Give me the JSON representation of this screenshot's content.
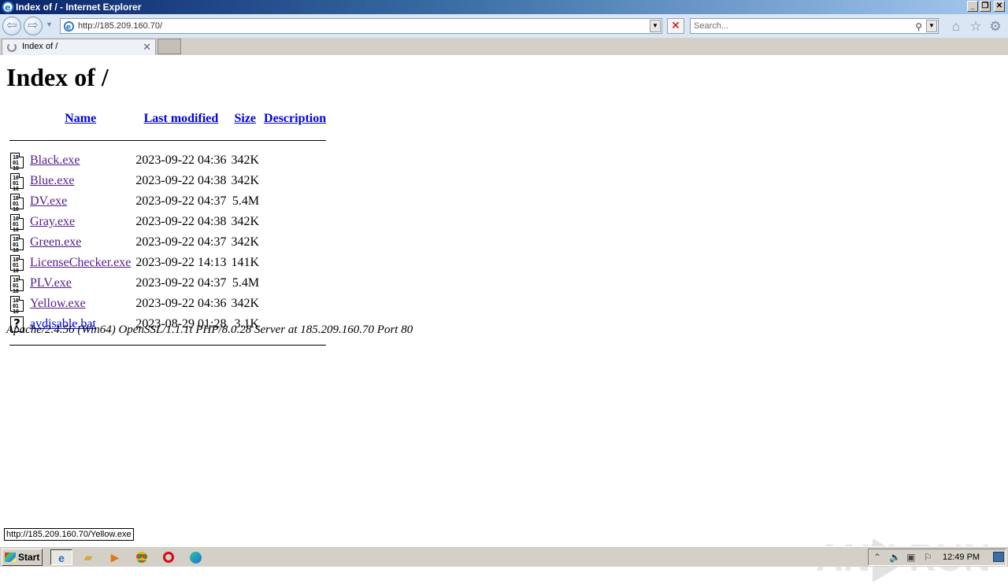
{
  "window": {
    "title": "Index of / - Internet Explorer",
    "buttons": [
      "minimize",
      "restore",
      "close"
    ]
  },
  "nav": {
    "url": "http://185.209.160.70/",
    "search_placeholder": "Search...",
    "icons": [
      "back-icon",
      "forward-icon",
      "home-icon",
      "favorites-icon",
      "tools-gear-icon"
    ]
  },
  "tab": {
    "label": "Index of /"
  },
  "page": {
    "title": "Index of /",
    "columns": [
      "Name",
      "Last modified",
      "Size",
      "Description"
    ],
    "files": [
      {
        "name": "Black.exe",
        "modified": "2023-09-22 04:36",
        "size": "342K",
        "description": "",
        "type": "binary"
      },
      {
        "name": "Blue.exe",
        "modified": "2023-09-22 04:38",
        "size": "342K",
        "description": "",
        "type": "binary"
      },
      {
        "name": "DV.exe",
        "modified": "2023-09-22 04:37",
        "size": "5.4M",
        "description": "",
        "type": "binary"
      },
      {
        "name": "Gray.exe",
        "modified": "2023-09-22 04:38",
        "size": "342K",
        "description": "",
        "type": "binary"
      },
      {
        "name": "Green.exe",
        "modified": "2023-09-22 04:37",
        "size": "342K",
        "description": "",
        "type": "binary"
      },
      {
        "name": "LicenseChecker.exe",
        "modified": "2023-09-22 14:13",
        "size": "141K",
        "description": "",
        "type": "binary"
      },
      {
        "name": "PLV.exe",
        "modified": "2023-09-22 04:37",
        "size": "5.4M",
        "description": "",
        "type": "binary"
      },
      {
        "name": "Yellow.exe",
        "modified": "2023-09-22 04:36",
        "size": "342K",
        "description": "",
        "type": "binary"
      },
      {
        "name": "avdisable.bat",
        "modified": "2023-08-29 01:28",
        "size": "3.1K",
        "description": "",
        "type": "unknown"
      }
    ],
    "footer": "Apache/2.4.56 (Win64) OpenSSL/1.1.1t PHP/8.0.28 Server at 185.209.160.70 Port 80"
  },
  "status": {
    "hover_url": "http://185.209.160.70/Yellow.exe"
  },
  "watermark": {
    "left": "ANY",
    "right": "RUN"
  },
  "taskbar": {
    "start_label": "Start",
    "clock": "12:49 PM",
    "apps": [
      "internet-explorer",
      "explorer-folder",
      "media-player",
      "chrome",
      "opera",
      "edge"
    ]
  }
}
